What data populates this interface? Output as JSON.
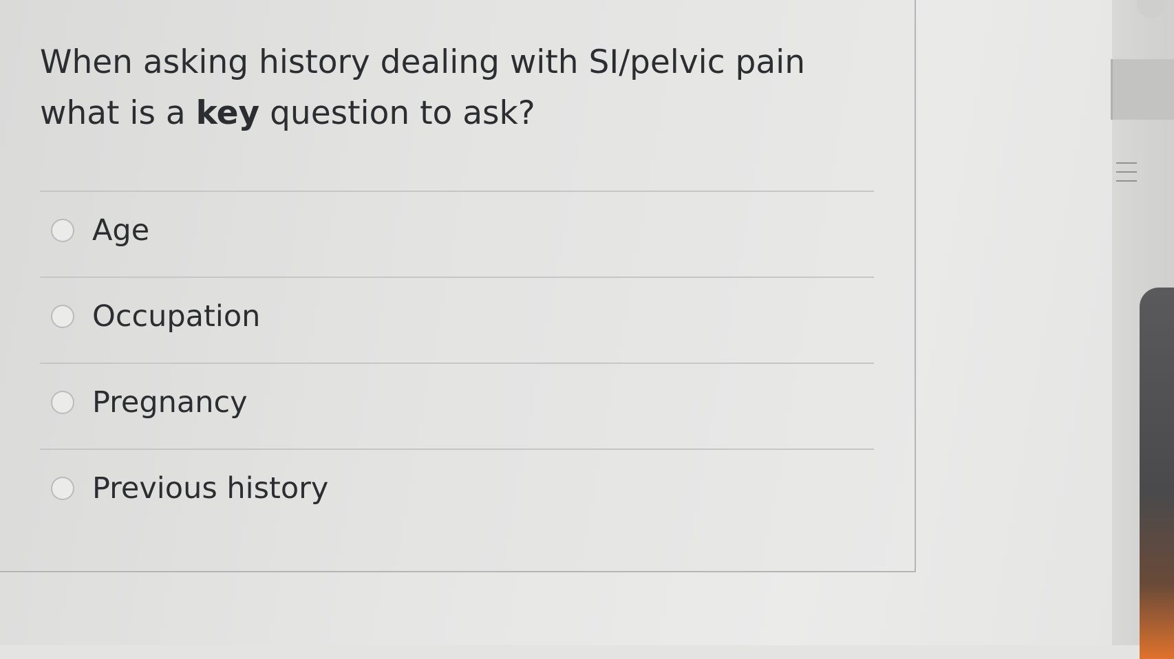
{
  "question": {
    "text_before": "When asking history dealing with SI/pelvic pain what is a ",
    "text_bold": "key",
    "text_after": " question to ask?"
  },
  "answers": [
    {
      "label": "Age",
      "selected": false
    },
    {
      "label": "Occupation",
      "selected": false
    },
    {
      "label": "Pregnancy",
      "selected": false
    },
    {
      "label": "Previous history",
      "selected": false
    }
  ],
  "icons": {
    "menu": "hamburger-menu-icon",
    "radio": "radio-unselected-icon"
  },
  "colors": {
    "text": "#2b2d31",
    "card_border": "#b4b5b6",
    "divider": "#c5c6c7",
    "radio_border": "#b9bbbe"
  }
}
